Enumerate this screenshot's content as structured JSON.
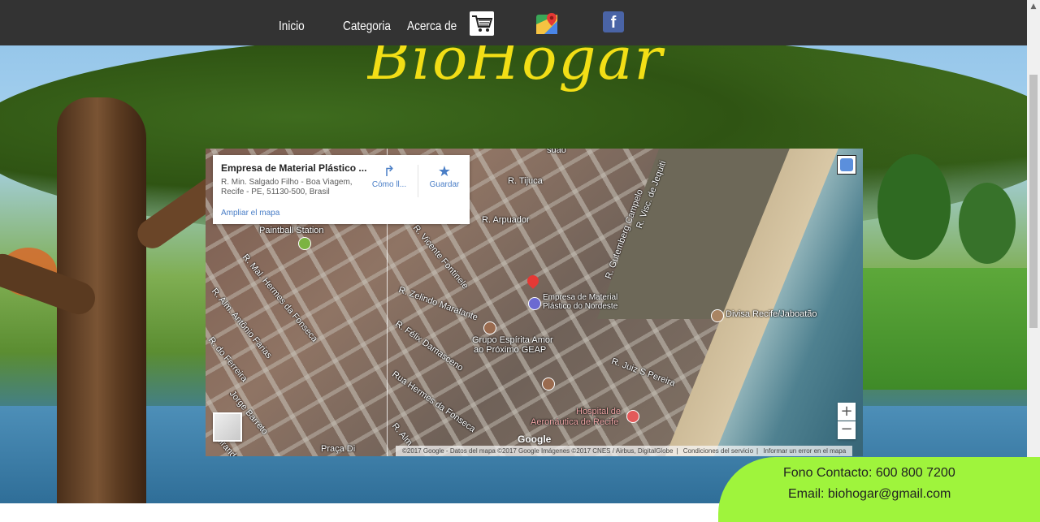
{
  "nav": {
    "items": [
      "Inicio",
      "Categoria",
      "Acerca de"
    ],
    "icons": [
      "cart-icon",
      "google-maps-icon",
      "facebook-icon"
    ]
  },
  "brand": {
    "title": "BioHogar",
    "color": "#f2de16"
  },
  "map": {
    "place_name": "Empresa de Material Plástico ...",
    "address": "R. Min. Salgado Filho - Boa Viagem, Recife - PE, 51130-500, Brasil",
    "directions_label": "Cómo ll...",
    "save_label": "Guardar",
    "enlarge_link": "Ampliar el mapa",
    "zoom_in": "+",
    "zoom_out": "−",
    "google": "Google",
    "labels": {
      "paintball": "Paintball Station",
      "tijuca": "R. Tijuca",
      "arpuador": "R. Arpuador",
      "fontinele": "R. Vicente Fontinele",
      "campelo": "R. Gutemberg Campelo",
      "visc_jequitinhonha": "R. Visc. de Jequiti",
      "hermes_fonseca": "R. Mal. Hermes da Fonseca",
      "antonio_farias": "R. Alm. Antônio Farias",
      "zeindo": "R. Zelindo Marafante",
      "felix": "R. Félix Damasceno",
      "ferreira": "R. do Ferreira",
      "barreto": "Jorge Barreto",
      "rua_hermes": "Rua Hermes da Fonseca",
      "business": "Empresa de Material",
      "business2": "Plástico do Nordeste",
      "grupo": "Grupo Espírita Amor",
      "grupo2": "ao Próximo GEAP",
      "divisa": "Divisa Recife/Jaboatão",
      "juiz": "R. Juiz S Pereira",
      "hospital": "Hospital de",
      "hospital2": "Aeronáutica de Recife",
      "praca": "Praça Di",
      "miranda": "Miranda",
      "alm": "R. Alm.",
      "topcut": "sdão"
    },
    "attribution": {
      "data": "©2017 Google - Datos del mapa ©2017 Google Imágenes ©2017 CNES / Airbus, DigitalGlobe",
      "terms": "Condiciones del servicio",
      "report": "Informar un error en el mapa"
    }
  },
  "contact": {
    "phone": "Fono Contacto: 600 800 7200",
    "email": "Email: biohogar@gmail.com",
    "bg_color": "#9ff43c"
  },
  "scrollbar": {
    "up": "▲",
    "down": "▼"
  }
}
